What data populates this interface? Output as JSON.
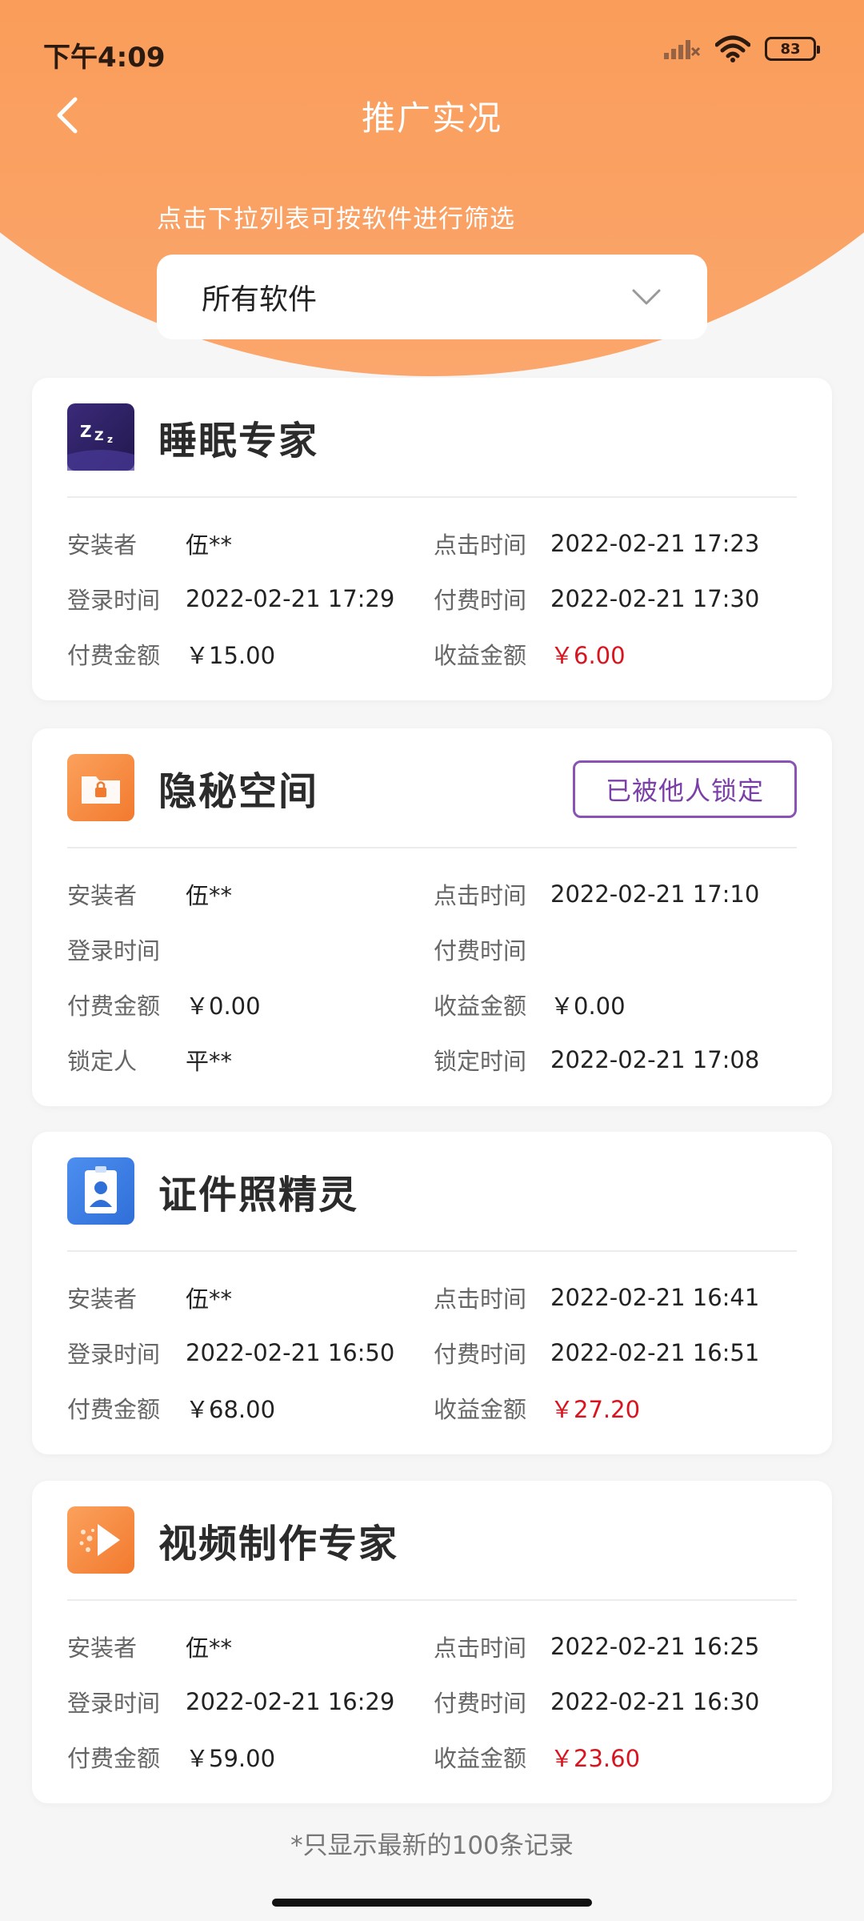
{
  "status_bar": {
    "time": "下午4:09",
    "battery": "83"
  },
  "nav": {
    "title": "推广实况"
  },
  "filter": {
    "hint": "点击下拉列表可按软件进行筛选",
    "selected": "所有软件"
  },
  "labels": {
    "installer": "安装者",
    "click_time": "点击时间",
    "login_time": "登录时间",
    "pay_time": "付费时间",
    "pay_amount": "付费金额",
    "income_amount": "收益金额",
    "locker": "锁定人",
    "lock_time": "锁定时间"
  },
  "cards": [
    {
      "name": "睡眠专家",
      "icon": "sleep-zzz-icon",
      "installer": "伍**",
      "click_time": "2022-02-21 17:23",
      "login_time": "2022-02-21 17:29",
      "pay_time": "2022-02-21 17:30",
      "pay_amount": "￥15.00",
      "income_amount": "￥6.00"
    },
    {
      "name": "隐秘空间",
      "icon": "locked-folder-icon",
      "badge": "已被他人锁定",
      "installer": "伍**",
      "click_time": "2022-02-21 17:10",
      "login_time": "",
      "pay_time": "",
      "pay_amount": "￥0.00",
      "income_amount": "￥0.00",
      "locker": "平**",
      "lock_time": "2022-02-21 17:08"
    },
    {
      "name": "证件照精灵",
      "icon": "id-photo-icon",
      "installer": "伍**",
      "click_time": "2022-02-21 16:41",
      "login_time": "2022-02-21 16:50",
      "pay_time": "2022-02-21 16:51",
      "pay_amount": "￥68.00",
      "income_amount": "￥27.20"
    },
    {
      "name": "视频制作专家",
      "icon": "video-play-icon",
      "installer": "伍**",
      "click_time": "2022-02-21 16:25",
      "login_time": "2022-02-21 16:29",
      "pay_time": "2022-02-21 16:30",
      "pay_amount": "￥59.00",
      "income_amount": "￥23.60"
    }
  ],
  "footer": {
    "note": "*只显示最新的100条记录"
  },
  "colors": {
    "header_orange": "#f7893f",
    "income_red": "#d9141f",
    "lock_purple": "#8a52b4"
  }
}
